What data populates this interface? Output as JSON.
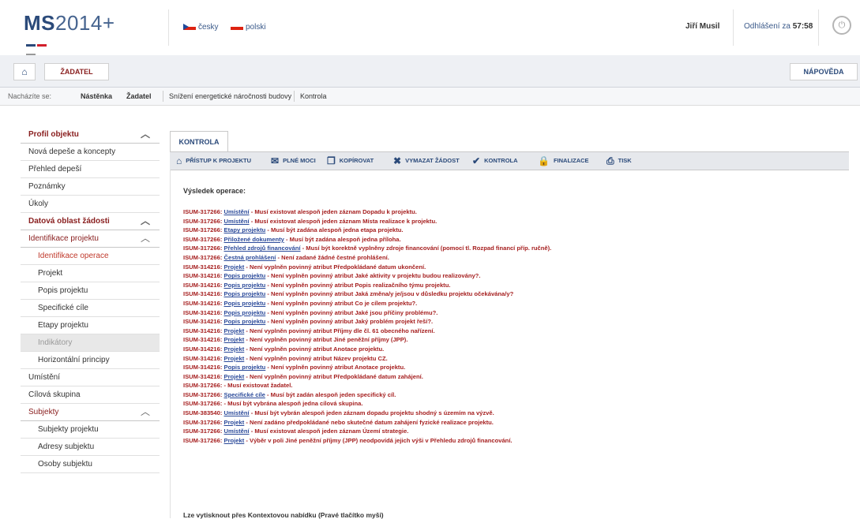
{
  "header": {
    "logo_ms": "MS",
    "logo_year": "2014+",
    "lang_cs": "česky",
    "lang_pl": "polski",
    "user_name": "Jiří Musil",
    "logout_label": "Odhlášení za",
    "logout_time": "57:58",
    "logo_colors": [
      "#2b4a7a",
      "#d21f2b",
      "#999999"
    ]
  },
  "nav": {
    "home_label": "⌂",
    "role_label": "ŽADATEL",
    "help_label": "NÁPOVĚDA"
  },
  "breadcrumbs": {
    "prefix": "Nacházíte se:",
    "items": [
      "Nástěnka",
      "Žadatel",
      "Snížení energetické náročnosti budovy",
      "Kontrola"
    ]
  },
  "sidebar": {
    "items": [
      {
        "label": "Profil objektu",
        "type": "hdr",
        "chev": "︿"
      },
      {
        "label": "Nová depeše a koncepty",
        "type": "normal"
      },
      {
        "label": "Přehled depeší",
        "type": "normal"
      },
      {
        "label": "Poznámky",
        "type": "normal"
      },
      {
        "label": "Úkoly",
        "type": "normal"
      },
      {
        "label": "Datová oblast žádosti",
        "type": "hdr",
        "chev": "︿"
      },
      {
        "label": "Identifikace projektu",
        "type": "hdr2",
        "chev": "︿"
      },
      {
        "label": "Identifikace operace",
        "type": "active"
      },
      {
        "label": "Projekt",
        "type": "sub"
      },
      {
        "label": "Popis projektu",
        "type": "sub"
      },
      {
        "label": "Specifické cíle",
        "type": "sub"
      },
      {
        "label": "Etapy projektu",
        "type": "sub"
      },
      {
        "label": "Indikátory",
        "type": "dim"
      },
      {
        "label": "Horizontální principy",
        "type": "sub"
      },
      {
        "label": "Umístění",
        "type": "normal"
      },
      {
        "label": "Cílová skupina",
        "type": "normal"
      },
      {
        "label": "Subjekty",
        "type": "hdr2",
        "chev": "︿"
      },
      {
        "label": "Subjekty projektu",
        "type": "sub"
      },
      {
        "label": "Adresy subjektu",
        "type": "sub"
      },
      {
        "label": "Osoby subjektu",
        "type": "sub"
      }
    ]
  },
  "content": {
    "tab_label": "KONTROLA",
    "toolbar": [
      {
        "icon": "⌂",
        "label": "PŘÍSTUP K PROJEKTU"
      },
      {
        "icon": "✉",
        "label": "PLNÉ MOCI"
      },
      {
        "icon": "❐",
        "label": "KOPÍROVAT"
      },
      {
        "icon": "✖",
        "label": "VYMAZAT ŽÁDOST"
      },
      {
        "icon": "✔",
        "label": "KONTROLA"
      },
      {
        "icon": "🔒",
        "label": "FINALIZACE"
      },
      {
        "icon": "⎙",
        "label": "TISK"
      }
    ],
    "result_title": "Výsledek operace:",
    "messages": [
      {
        "code": "ISUM-317266:",
        "link": "Umístění",
        "text": " - Musí existovat alespoň jeden záznam Dopadu k projektu."
      },
      {
        "code": "ISUM-317266:",
        "link": "Umístění",
        "text": " - Musí existovat alespoň jeden záznam Místa realizace k projektu."
      },
      {
        "code": "ISUM-317266:",
        "link": "Etapy projektu",
        "text": " - Musí být zadána alespoň jedna etapa projektu."
      },
      {
        "code": "ISUM-317266:",
        "link": "Přiložené dokumenty",
        "text": " - Musí být zadána alespoň jedna příloha."
      },
      {
        "code": "ISUM-317266:",
        "link": "Přehled zdrojů financování",
        "text": " - Musí být korektně vyplněny zdroje financování (pomocí tl. Rozpad financí příp. ručně)."
      },
      {
        "code": "ISUM-317266:",
        "link": "Čestná prohlášení",
        "text": " - Není zadané žádné čestné prohlášení."
      },
      {
        "code": "ISUM-314216:",
        "link": "Projekt",
        "text": " - Není vyplněn povinný atribut Předpokládané datum ukončení."
      },
      {
        "code": "ISUM-314216:",
        "link": "Popis projektu",
        "text": " - Není vyplněn povinný atribut Jaké aktivity v projektu budou realizovány?."
      },
      {
        "code": "ISUM-314216:",
        "link": "Popis projektu",
        "text": " - Není vyplněn povinný atribut Popis realizačního týmu projektu."
      },
      {
        "code": "ISUM-314216:",
        "link": "Popis projektu",
        "text": " - Není vyplněn povinný atribut Jaká změna/y je/jsou v důsledku projektu očekávána/y?"
      },
      {
        "code": "ISUM-314216:",
        "link": "Popis projektu",
        "text": " - Není vyplněn povinný atribut Co je cílem projektu?."
      },
      {
        "code": "ISUM-314216:",
        "link": "Popis projektu",
        "text": " - Není vyplněn povinný atribut Jaké jsou příčiny problému?."
      },
      {
        "code": "ISUM-314216:",
        "link": "Popis projektu",
        "text": " - Není vyplněn povinný atribut Jaký problém projekt řeší?."
      },
      {
        "code": "ISUM-314216:",
        "link": "Projekt",
        "text": " - Není vyplněn povinný atribut Příjmy dle čl. 61 obecného nařízení."
      },
      {
        "code": "ISUM-314216:",
        "link": "Projekt",
        "text": " - Není vyplněn povinný atribut Jiné peněžní příjmy (JPP)."
      },
      {
        "code": "ISUM-314216:",
        "link": "Projekt",
        "text": " - Není vyplněn povinný atribut Anotace projektu."
      },
      {
        "code": "ISUM-314216:",
        "link": "Projekt",
        "text": " - Není vyplněn povinný atribut Název projektu CZ."
      },
      {
        "code": "ISUM-314216:",
        "link": "Popis projektu",
        "text": " - Není vyplněn povinný atribut Anotace projektu."
      },
      {
        "code": "ISUM-314216:",
        "link": "Projekt",
        "text": " - Není vyplněn povinný atribut Předpokládané datum zahájení."
      },
      {
        "code": "ISUM-317266:",
        "link": "",
        "text": " - Musí existovat žadatel."
      },
      {
        "code": "ISUM-317266:",
        "link": "Specifické cíle",
        "text": " - Musí být zadán alespoň jeden specifický cíl."
      },
      {
        "code": "ISUM-317266:",
        "link": "",
        "text": " - Musí být vybrána alespoň jedna cílová skupina."
      },
      {
        "code": "ISUM-383540:",
        "link": "Umístění",
        "text": " - Musí být vybrán alespoň jeden záznam dopadu projektu shodný s územím na výzvě."
      },
      {
        "code": "ISUM-317266:",
        "link": "Projekt",
        "text": " - Není zadáno předpokládané nebo skutečné datum zahájení fyzické realizace projektu."
      },
      {
        "code": "ISUM-317266:",
        "link": "Umístění",
        "text": " - Musí existovat alespoň jeden záznam Území strategie."
      },
      {
        "code": "ISUM-317266:",
        "link": "Projekt",
        "text": " - Výběr v poli Jiné peněžní příjmy (JPP) neodpovídá jejich výši v Přehledu zdrojů financování."
      }
    ],
    "footer_note": "Lze vytisknout přes Kontextovou nabídku (Pravé tlačítko myši)"
  }
}
